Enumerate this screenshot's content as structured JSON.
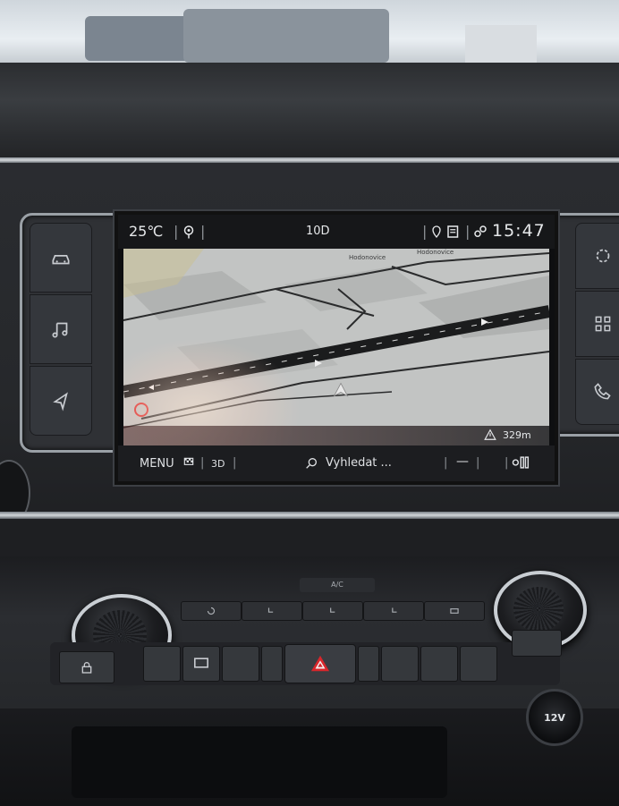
{
  "status_bar": {
    "temperature": "25℃",
    "station": "10D",
    "time": "15:47"
  },
  "map": {
    "street_labels": [
      "Hodonovice",
      "Hodonovice"
    ],
    "distance": "329m"
  },
  "bottom_bar": {
    "menu_label": "MENU",
    "view_label": "3D",
    "search_label": "Vyhledat ..."
  },
  "console": {
    "ac_label": "A/C",
    "socket_label": "12V"
  },
  "icons": {
    "left_buttons": [
      "car-icon",
      "music-note-icon",
      "navigation-icon"
    ],
    "right_buttons": [
      "settings-icon",
      "apps-grid-icon",
      "phone-icon"
    ]
  }
}
